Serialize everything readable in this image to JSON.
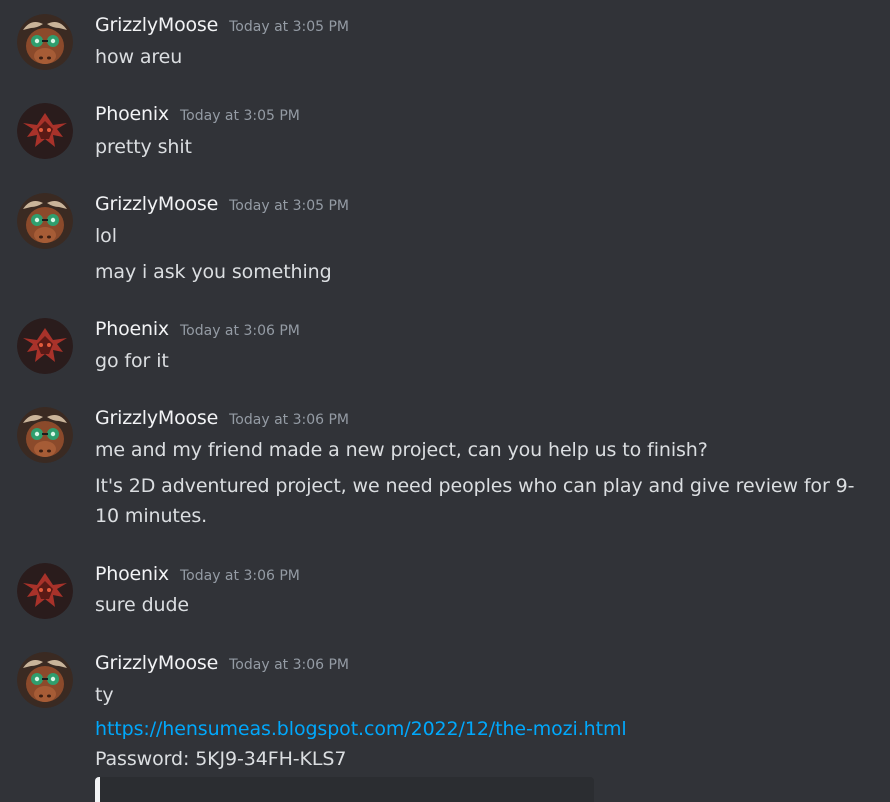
{
  "messages": [
    {
      "author": "GrizzlyMoose",
      "time": "Today at 3:05 PM",
      "avatar": "moose-avatar",
      "lines": [
        "how areu"
      ]
    },
    {
      "author": "Phoenix",
      "time": "Today at 3:05 PM",
      "avatar": "phoenix-avatar",
      "lines": [
        "pretty shit"
      ]
    },
    {
      "author": "GrizzlyMoose",
      "time": "Today at 3:05 PM",
      "avatar": "moose-avatar",
      "lines": [
        "lol",
        "may i ask you something"
      ]
    },
    {
      "author": "Phoenix",
      "time": "Today at 3:06 PM",
      "avatar": "phoenix-avatar",
      "lines": [
        "go for it"
      ]
    },
    {
      "author": "GrizzlyMoose",
      "time": "Today at 3:06 PM",
      "avatar": "moose-avatar",
      "lines": [
        "me and my friend made a new project, can you help us to finish?",
        "It's 2D adventured project, we need peoples who can play and give review for 9-10 minutes."
      ]
    },
    {
      "author": "Phoenix",
      "time": "Today at 3:06 PM",
      "avatar": "phoenix-avatar",
      "lines": [
        "sure dude"
      ]
    },
    {
      "author": "GrizzlyMoose",
      "time": "Today at 3:06 PM",
      "avatar": "moose-avatar",
      "lines": [
        "ty",
        "https://hensumeas.blogspot.com/2022/12/the-mozi.html",
        "Password: 5KJ9-34FH-KLS7"
      ]
    }
  ],
  "colors": {
    "background": "#313338",
    "username": "#f2f3f5",
    "timestamp": "#949ba4",
    "message_text": "#dbdee1",
    "link": "#00a8fc",
    "embed_background": "#2b2d31"
  }
}
